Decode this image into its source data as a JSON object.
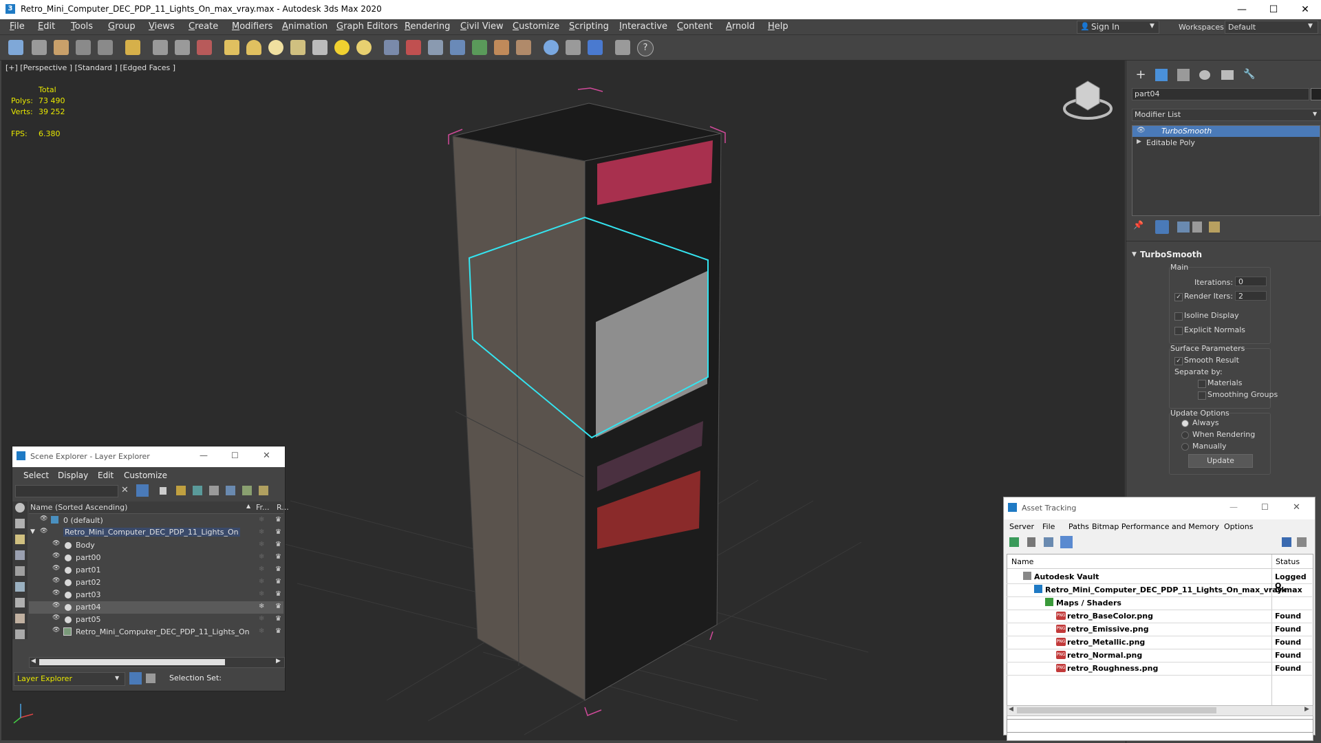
{
  "window": {
    "title": "Retro_Mini_Computer_DEC_PDP_11_Lights_On_max_vray.max - Autodesk 3ds Max 2020",
    "app_icon": "3",
    "minimize": "—",
    "maximize": "☐",
    "close": "✕"
  },
  "menu": [
    "File",
    "Edit",
    "Tools",
    "Group",
    "Views",
    "Create",
    "Modifiers",
    "Animation",
    "Graph Editors",
    "Rendering",
    "Civil View",
    "Customize",
    "Scripting",
    "Interactive",
    "Content",
    "Arnold",
    "Help"
  ],
  "account": {
    "sign_in": "Sign In",
    "workspaces_label": "Workspaces:",
    "workspace_value": "Default"
  },
  "viewport": {
    "label": "[+] [Perspective ] [Standard ] [Edged Faces ]",
    "stats": {
      "total_label": "Total",
      "polys_label": "Polys:",
      "polys_value": "73 490",
      "verts_label": "Verts:",
      "verts_value": "39 252",
      "fps_label": "FPS:",
      "fps_value": "6.380"
    }
  },
  "command_panel": {
    "object_name": "part04",
    "modifier_list_label": "Modifier List",
    "stack": [
      {
        "label": "TurboSmooth",
        "selected": true
      },
      {
        "label": "Editable Poly",
        "selected": false
      }
    ],
    "rollout_title": "TurboSmooth",
    "main_label": "Main",
    "iterations_label": "Iterations:",
    "iterations_value": "0",
    "render_iters_label": "Render Iters:",
    "render_iters_value": "2",
    "isoline_label": "Isoline Display",
    "explicit_normals_label": "Explicit Normals",
    "surface_params_label": "Surface Parameters",
    "smooth_result_label": "Smooth Result",
    "separate_by_label": "Separate by:",
    "materials_label": "Materials",
    "smoothing_groups_label": "Smoothing Groups",
    "update_options_label": "Update Options",
    "always_label": "Always",
    "when_rendering_label": "When Rendering",
    "manually_label": "Manually",
    "update_button": "Update"
  },
  "scene_explorer": {
    "title": "Scene Explorer - Layer Explorer",
    "menu": [
      "Select",
      "Display",
      "Edit",
      "Customize"
    ],
    "col_name": "Name (Sorted Ascending)",
    "col_fr": "Fr...",
    "col_r": "R...",
    "rows": [
      {
        "label": "0 (default)",
        "indent": 0,
        "selected": false
      },
      {
        "label": "Retro_Mini_Computer_DEC_PDP_11_Lights_On",
        "indent": 0,
        "selected": false,
        "highlight": true
      },
      {
        "label": "Body",
        "indent": 1,
        "selected": false
      },
      {
        "label": "part00",
        "indent": 1,
        "selected": false
      },
      {
        "label": "part01",
        "indent": 1,
        "selected": false
      },
      {
        "label": "part02",
        "indent": 1,
        "selected": false
      },
      {
        "label": "part03",
        "indent": 1,
        "selected": false
      },
      {
        "label": "part04",
        "indent": 1,
        "selected": true
      },
      {
        "label": "part05",
        "indent": 1,
        "selected": false
      },
      {
        "label": "Retro_Mini_Computer_DEC_PDP_11_Lights_On",
        "indent": 1,
        "selected": false
      }
    ],
    "footer_layer": "Layer Explorer",
    "footer_selection": "Selection Set:"
  },
  "asset_tracking": {
    "title": "Asset Tracking",
    "menu": [
      "Server",
      "File",
      "Paths",
      "Bitmap Performance and Memory",
      "Options"
    ],
    "col_name": "Name",
    "col_status": "Status",
    "rows": [
      {
        "label": "Autodesk Vault",
        "status": "Logged O",
        "indent": 1
      },
      {
        "label": "Retro_Mini_Computer_DEC_PDP_11_Lights_On_max_vray.max",
        "status": "Ok",
        "indent": 2
      },
      {
        "label": "Maps / Shaders",
        "status": "",
        "indent": 3
      },
      {
        "label": "retro_BaseColor.png",
        "status": "Found",
        "indent": 4
      },
      {
        "label": "retro_Emissive.png",
        "status": "Found",
        "indent": 4
      },
      {
        "label": "retro_Metallic.png",
        "status": "Found",
        "indent": 4
      },
      {
        "label": "retro_Normal.png",
        "status": "Found",
        "indent": 4
      },
      {
        "label": "retro_Roughness.png",
        "status": "Found",
        "indent": 4
      }
    ]
  }
}
